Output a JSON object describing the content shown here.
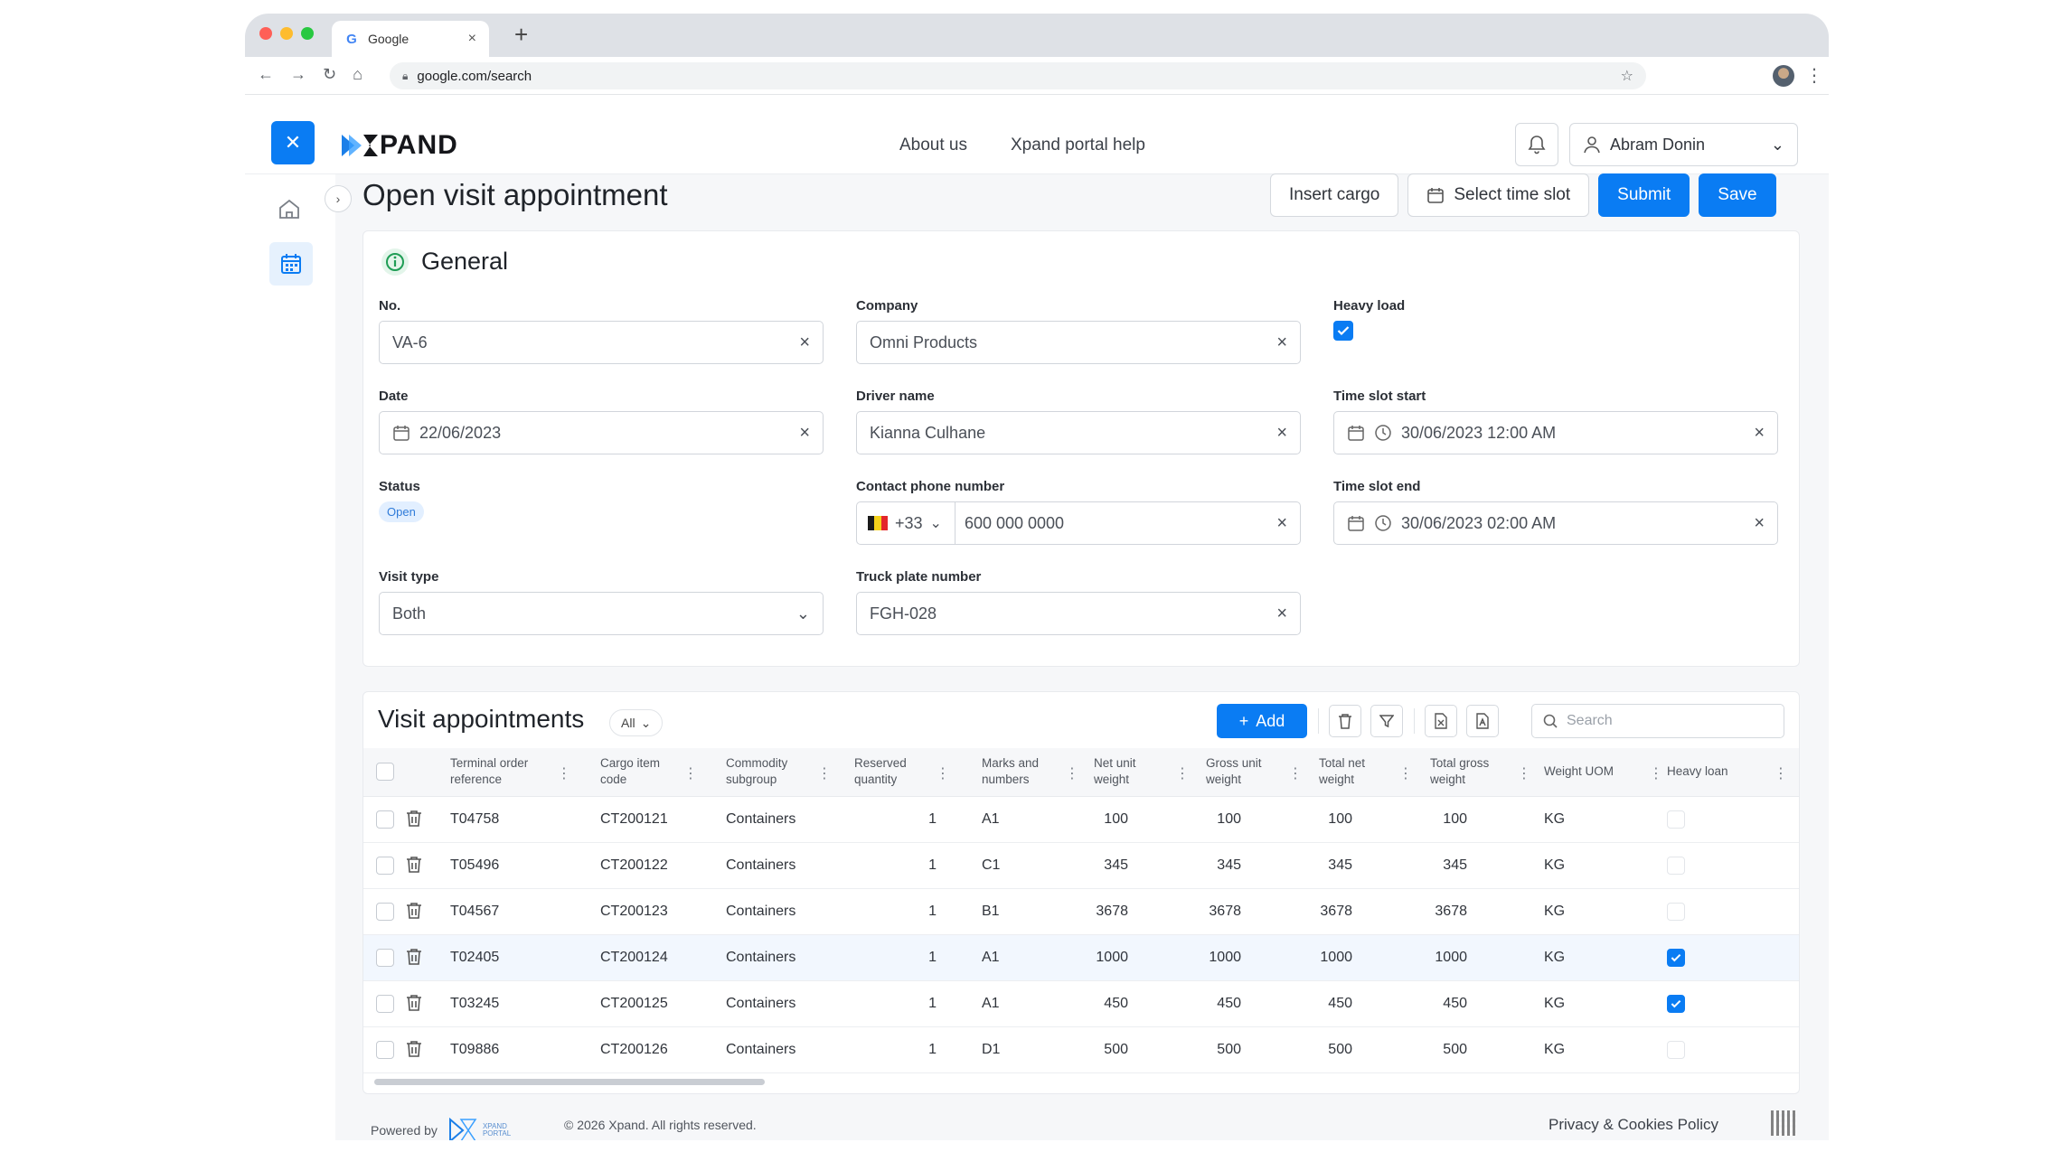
{
  "browser": {
    "tab_title": "Google",
    "url": "google.com/search"
  },
  "header": {
    "logo_text": "PAND",
    "nav": [
      "About us",
      "Xpand portal help"
    ],
    "user_name": "Abram Donin"
  },
  "page": {
    "title": "Open visit appointment",
    "actions": {
      "insert_cargo": "Insert cargo",
      "select_time_slot": "Select time slot",
      "submit": "Submit",
      "save": "Save"
    }
  },
  "general": {
    "title": "General",
    "no": {
      "label": "No.",
      "value": "VA-6"
    },
    "company": {
      "label": "Company",
      "value": "Omni Products"
    },
    "heavy_load": {
      "label": "Heavy load",
      "checked": true
    },
    "date": {
      "label": "Date",
      "value": "22/06/2023"
    },
    "driver_name": {
      "label": "Driver name",
      "value": "Kianna Culhane"
    },
    "time_slot_start": {
      "label": "Time slot start",
      "value": "30/06/2023 12:00 AM"
    },
    "status": {
      "label": "Status",
      "value": "Open"
    },
    "contact_phone": {
      "label": "Contact phone number",
      "prefix": "+33",
      "value": "600 000 0000"
    },
    "time_slot_end": {
      "label": "Time slot end",
      "value": "30/06/2023 02:00 AM"
    },
    "visit_type": {
      "label": "Visit type",
      "value": "Both"
    },
    "truck_plate": {
      "label": "Truck plate number",
      "value": "FGH-028"
    }
  },
  "visits": {
    "title": "Visit appointments",
    "filter": "All",
    "add_label": "Add",
    "search_placeholder": "Search",
    "columns": [
      [
        "Terminal order",
        "reference"
      ],
      [
        "Cargo item",
        "code"
      ],
      [
        "Commodity",
        "subgroup"
      ],
      [
        "Reserved",
        "quantity"
      ],
      [
        "Marks and",
        "numbers"
      ],
      [
        "Net unit",
        "weight"
      ],
      [
        "Gross unit",
        "weight"
      ],
      [
        "Total net",
        "weight"
      ],
      [
        "Total gross",
        "weight"
      ],
      [
        "Weight UOM",
        ""
      ],
      [
        "Heavy loan",
        ""
      ]
    ],
    "rows": [
      {
        "ref": "T04758",
        "code": "CT200121",
        "subgroup": "Containers",
        "qty": "1",
        "marks": "A1",
        "net": "100",
        "gross": "100",
        "total_net": "100",
        "total_gross": "100",
        "uom": "KG",
        "heavy": false,
        "highlight": false
      },
      {
        "ref": "T05496",
        "code": "CT200122",
        "subgroup": "Containers",
        "qty": "1",
        "marks": "C1",
        "net": "345",
        "gross": "345",
        "total_net": "345",
        "total_gross": "345",
        "uom": "KG",
        "heavy": false,
        "highlight": false
      },
      {
        "ref": "T04567",
        "code": "CT200123",
        "subgroup": "Containers",
        "qty": "1",
        "marks": "B1",
        "net": "3678",
        "gross": "3678",
        "total_net": "3678",
        "total_gross": "3678",
        "uom": "KG",
        "heavy": false,
        "highlight": false
      },
      {
        "ref": "T02405",
        "code": "CT200124",
        "subgroup": "Containers",
        "qty": "1",
        "marks": "A1",
        "net": "1000",
        "gross": "1000",
        "total_net": "1000",
        "total_gross": "1000",
        "uom": "KG",
        "heavy": true,
        "highlight": true
      },
      {
        "ref": "T03245",
        "code": "CT200125",
        "subgroup": "Containers",
        "qty": "1",
        "marks": "A1",
        "net": "450",
        "gross": "450",
        "total_net": "450",
        "total_gross": "450",
        "uom": "KG",
        "heavy": true,
        "highlight": false
      },
      {
        "ref": "T09886",
        "code": "CT200126",
        "subgroup": "Containers",
        "qty": "1",
        "marks": "D1",
        "net": "500",
        "gross": "500",
        "total_net": "500",
        "total_gross": "500",
        "uom": "KG",
        "heavy": false,
        "highlight": false
      }
    ]
  },
  "footer": {
    "powered_by": "Powered by",
    "brand_small": "XPAND PORTAL",
    "copyright": "© 2026 Xpand. All rights reserved.",
    "privacy": "Privacy & Cookies Policy"
  },
  "colors": {
    "primary": "#0a7cf3",
    "status_badge_bg": "#e2efff",
    "info_icon": "#1f9d55"
  }
}
